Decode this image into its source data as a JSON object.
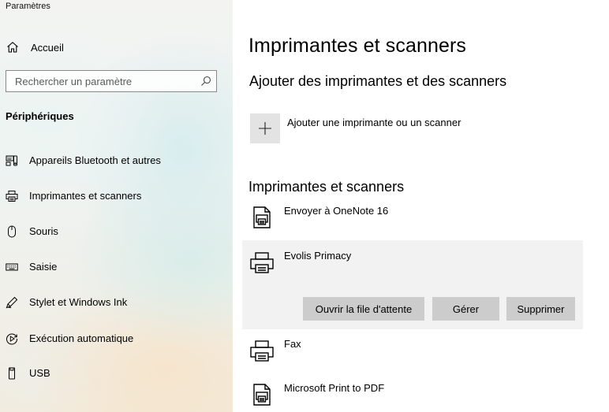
{
  "window": {
    "title": "Paramètres"
  },
  "sidebar": {
    "home_label": "Accueil",
    "search_placeholder": "Rechercher un paramètre",
    "section_title": "Périphériques",
    "items": [
      {
        "label": "Appareils Bluetooth et autres",
        "icon": "bluetooth-devices-icon"
      },
      {
        "label": "Imprimantes et scanners",
        "icon": "printer-icon"
      },
      {
        "label": "Souris",
        "icon": "mouse-icon"
      },
      {
        "label": "Saisie",
        "icon": "keyboard-icon"
      },
      {
        "label": "Stylet et Windows Ink",
        "icon": "pen-icon"
      },
      {
        "label": "Exécution automatique",
        "icon": "autoplay-icon"
      },
      {
        "label": "USB",
        "icon": "usb-icon"
      }
    ]
  },
  "main": {
    "title": "Imprimantes et scanners",
    "add_section_title": "Ajouter des imprimantes et des scanners",
    "add_label": "Ajouter une imprimante ou un scanner",
    "list_title": "Imprimantes et scanners",
    "printers": [
      {
        "name": "Envoyer à OneNote 16",
        "icon": "document-printer-icon"
      },
      {
        "name": "Evolis Primacy",
        "icon": "printer-icon",
        "selected": true
      },
      {
        "name": "Fax",
        "icon": "printer-icon"
      },
      {
        "name": "Microsoft Print to PDF",
        "icon": "document-printer-icon"
      }
    ],
    "actions": {
      "queue_label": "Ouvrir la file d'attente",
      "manage_label": "Gérer",
      "remove_label": "Supprimer"
    }
  },
  "colors": {
    "button_bg": "#cccccc",
    "selected_bg": "#f2f2f2",
    "add_tile_bg": "#e3e3e3"
  }
}
